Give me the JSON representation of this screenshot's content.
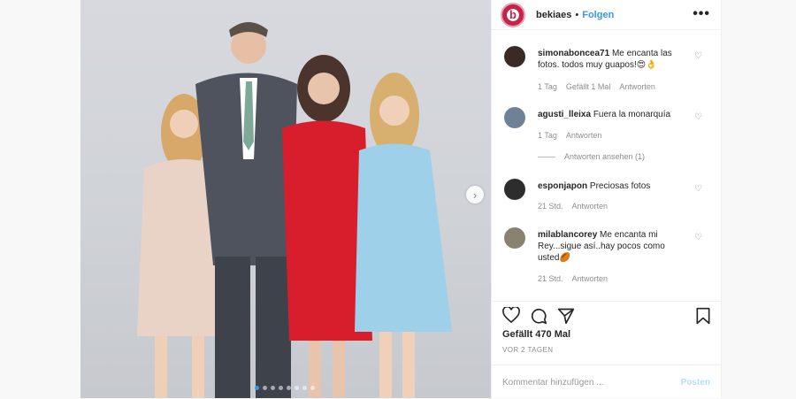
{
  "post": {
    "account": "bekiaes",
    "separator": "•",
    "follow_label": "Folgen",
    "more_icon": "more-dots-icon",
    "likes": "Gefällt 470 Mal",
    "date": "VOR 2 TAGEN",
    "comment_placeholder": "Kommentar hinzufügen ...",
    "post_label": "Posten",
    "carousel": {
      "count": 8,
      "active_index": 0
    }
  },
  "comments": [
    {
      "user": "simonabonc​ea71",
      "text": "Me encanta las fotos. todos muy guapos!😍👌",
      "time": "1 Tag",
      "likes": "Gefällt 1 Mal",
      "reply": "Antworten"
    },
    {
      "user": "agusti_lleixa",
      "text": "Fuera la monarquía",
      "time": "1 Tag",
      "reply": "Antworten",
      "view_replies": "Antworten ansehen (1)"
    },
    {
      "user": "esponjapon",
      "text": "Preciosas fotos",
      "time": "21 Std.",
      "reply": "Antworten"
    },
    {
      "user": "milablancorey",
      "text": "Me encanta mi Rey...sigue así..hay pocos como usted🏉",
      "time": "21 Std.",
      "reply": "Antworten"
    }
  ],
  "colors": {
    "accent": "#3897f0",
    "brand": "#c4244a"
  }
}
